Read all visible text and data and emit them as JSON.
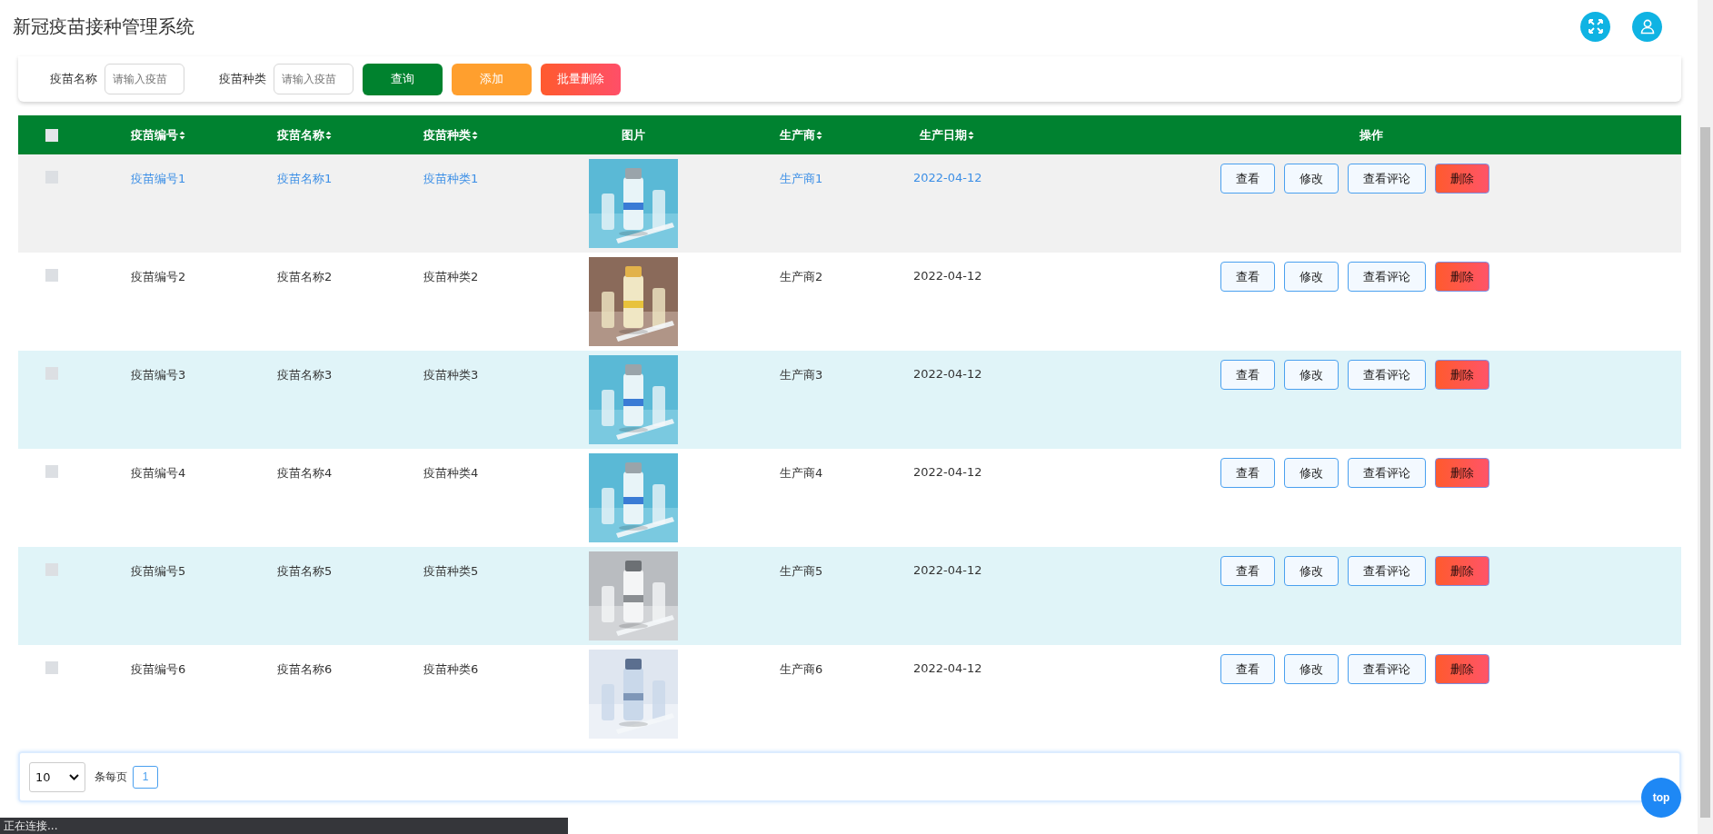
{
  "header": {
    "title": "新冠疫苗接种管理系统"
  },
  "search": {
    "fields": [
      {
        "label": "疫苗名称",
        "placeholder": "请输入疫苗"
      },
      {
        "label": "疫苗种类",
        "placeholder": "请输入疫苗"
      }
    ],
    "buttons": [
      {
        "label": "查询",
        "kind": "primary"
      },
      {
        "label": "添加",
        "kind": "warning"
      },
      {
        "label": "批量删除",
        "kind": "danger"
      }
    ]
  },
  "table": {
    "select_all": {
      "checked": false
    },
    "columns": [
      {
        "label": "疫苗编号",
        "sortable": true
      },
      {
        "label": "疫苗名称",
        "sortable": true
      },
      {
        "label": "疫苗种类",
        "sortable": true
      },
      {
        "label": "图片",
        "sortable": false
      },
      {
        "label": "生产商",
        "sortable": true
      },
      {
        "label": "生产日期",
        "sortable": true
      },
      {
        "label": "操作",
        "sortable": false
      }
    ],
    "rows": [
      {
        "checked": false,
        "hovered": true,
        "code": "疫苗编号1",
        "name": "疫苗名称1",
        "type": "疫苗种类1",
        "maker": "生产商1",
        "date": "2022-04-12",
        "actions": [
          {
            "label": "查看",
            "kind": "default"
          },
          {
            "label": "修改",
            "kind": "default"
          },
          {
            "label": "查看评论",
            "kind": "default"
          },
          {
            "label": "删除",
            "kind": "danger"
          }
        ]
      },
      {
        "checked": false,
        "hovered": false,
        "code": "疫苗编号2",
        "name": "疫苗名称2",
        "type": "疫苗种类2",
        "maker": "生产商2",
        "date": "2022-04-12",
        "actions": [
          {
            "label": "查看",
            "kind": "default"
          },
          {
            "label": "修改",
            "kind": "default"
          },
          {
            "label": "查看评论",
            "kind": "default"
          },
          {
            "label": "删除",
            "kind": "danger"
          }
        ]
      },
      {
        "checked": false,
        "hovered": false,
        "code": "疫苗编号3",
        "name": "疫苗名称3",
        "type": "疫苗种类3",
        "maker": "生产商3",
        "date": "2022-04-12",
        "actions": [
          {
            "label": "查看",
            "kind": "default"
          },
          {
            "label": "修改",
            "kind": "default"
          },
          {
            "label": "查看评论",
            "kind": "default"
          },
          {
            "label": "删除",
            "kind": "danger"
          }
        ]
      },
      {
        "checked": false,
        "hovered": false,
        "code": "疫苗编号4",
        "name": "疫苗名称4",
        "type": "疫苗种类4",
        "maker": "生产商4",
        "date": "2022-04-12",
        "actions": [
          {
            "label": "查看",
            "kind": "default"
          },
          {
            "label": "修改",
            "kind": "default"
          },
          {
            "label": "查看评论",
            "kind": "default"
          },
          {
            "label": "删除",
            "kind": "danger"
          }
        ]
      },
      {
        "checked": false,
        "hovered": false,
        "code": "疫苗编号5",
        "name": "疫苗名称5",
        "type": "疫苗种类5",
        "maker": "生产商5",
        "date": "2022-04-12",
        "actions": [
          {
            "label": "查看",
            "kind": "default"
          },
          {
            "label": "修改",
            "kind": "default"
          },
          {
            "label": "查看评论",
            "kind": "default"
          },
          {
            "label": "删除",
            "kind": "danger"
          }
        ]
      },
      {
        "checked": false,
        "hovered": false,
        "code": "疫苗编号6",
        "name": "疫苗名称6",
        "type": "疫苗种类6",
        "maker": "生产商6",
        "date": "2022-04-12",
        "actions": [
          {
            "label": "查看",
            "kind": "default"
          },
          {
            "label": "修改",
            "kind": "default"
          },
          {
            "label": "查看评论",
            "kind": "default"
          },
          {
            "label": "删除",
            "kind": "danger"
          }
        ]
      }
    ]
  },
  "pagination": {
    "page_size": "10",
    "size_label": "条每页",
    "pages": [
      {
        "label": "1",
        "selected": true
      }
    ]
  },
  "back_to_top": {
    "label": "top"
  },
  "status_bar": {
    "text": "正在连接..."
  }
}
